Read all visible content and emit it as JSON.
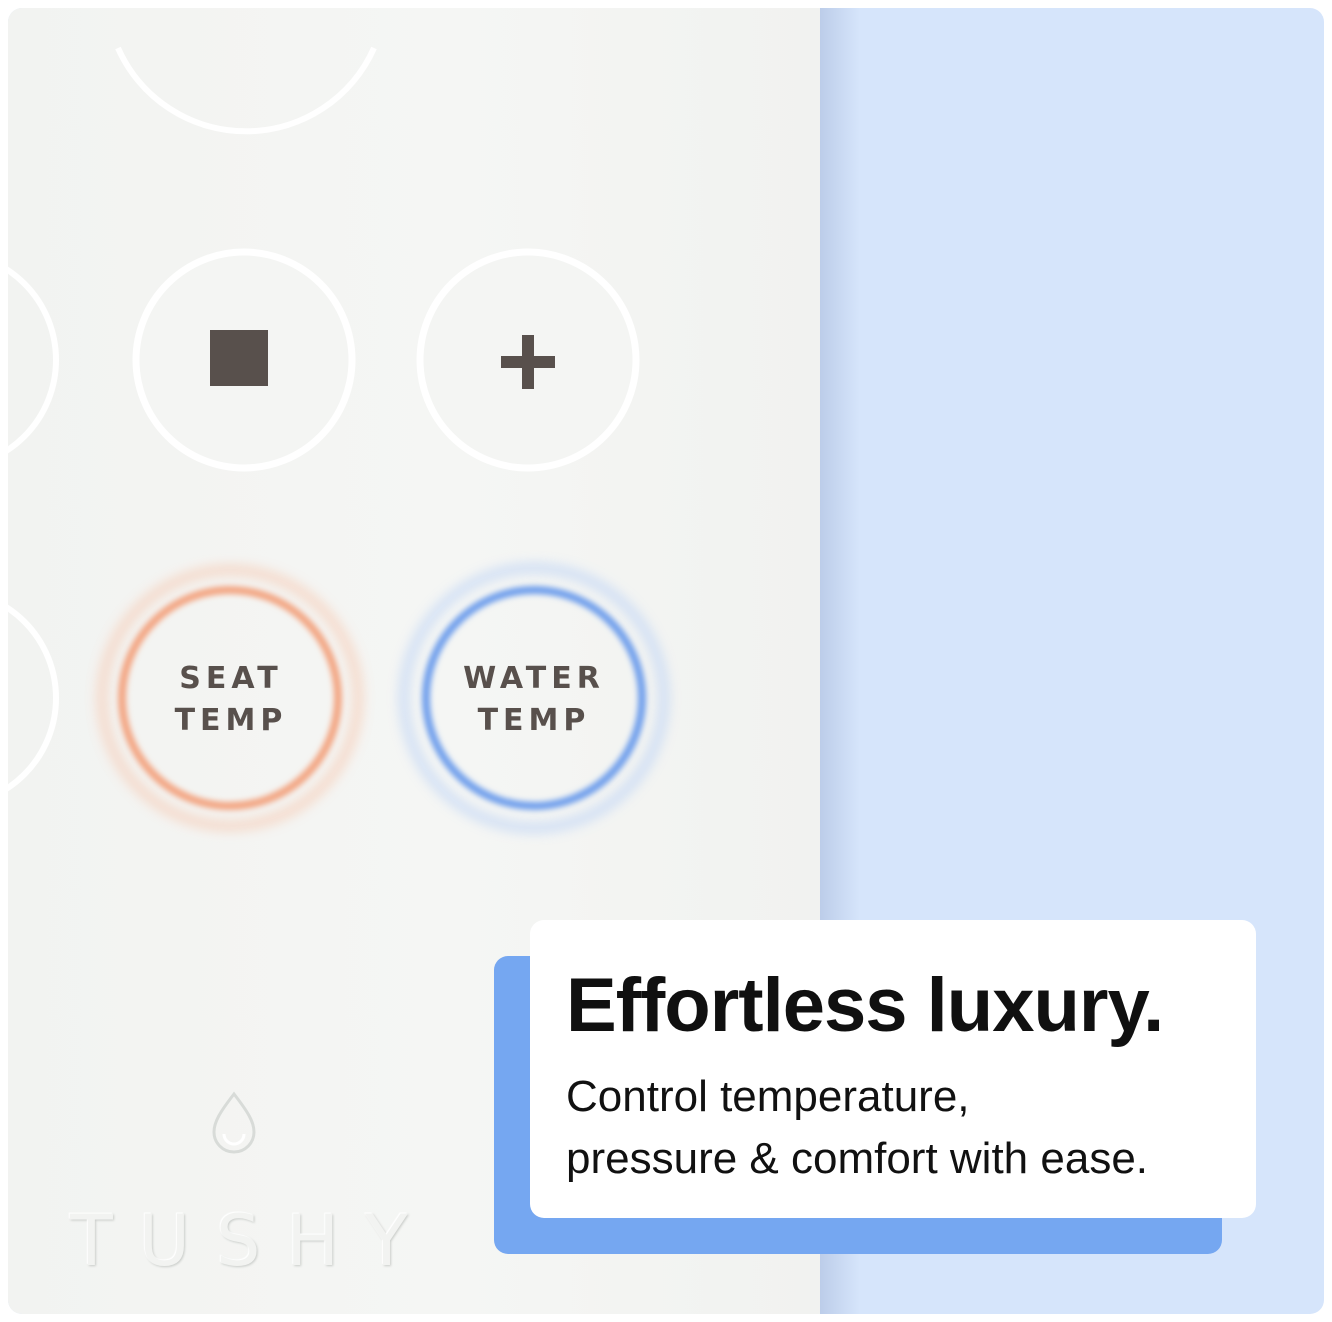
{
  "controls": {
    "seat_temp_label": "SEAT\nTEMP",
    "water_temp_label": "WATER\nTEMP",
    "stop_icon": "stop-square-icon",
    "plus_icon": "plus-icon"
  },
  "brand": {
    "name": "TUSHY",
    "logo_icon": "water-drop-logo-icon"
  },
  "card": {
    "headline": "Effortless luxury.",
    "subline": "Control temperature,\npressure & comfort with ease."
  },
  "colors": {
    "background_blue": "#d6e5fb",
    "card_accent": "#75a7f1",
    "seat_ring": "#f3a582",
    "water_ring": "#6f9fec",
    "icon_dark": "#58504c"
  }
}
